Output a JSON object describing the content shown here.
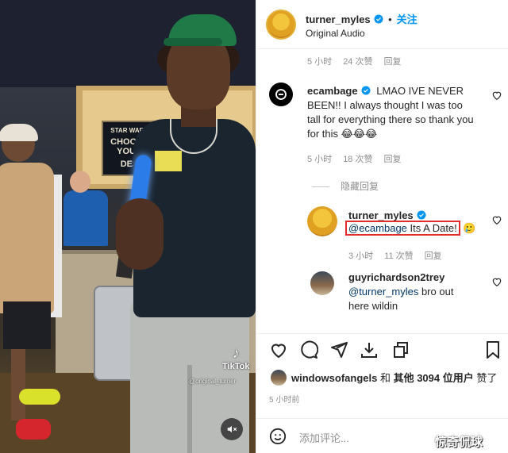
{
  "video": {
    "tiktok_logo": "TikTok",
    "tiktok_handle": "@original_turner",
    "sign_line1": "STAR WARS",
    "sign_line2": "CHOOSE YOUR",
    "sign_line3": "DES",
    "cap_text": "",
    "mute_icon": "speaker-muted-icon"
  },
  "header": {
    "username": "turner_myles",
    "follow_label": "关注",
    "audio_label": "Original Audio"
  },
  "comments": [
    {
      "id": "c0",
      "meta": {
        "time": "5 小时",
        "likes": "24 次赞",
        "reply": "回复"
      }
    },
    {
      "id": "c1",
      "username": "ecambage",
      "text": "LMAO IVE NEVER BEEN!! I always thought I was too tall for everything there so thank you for this 😂😂😂",
      "meta": {
        "time": "5 小时",
        "likes": "18 次赞",
        "reply": "回复"
      },
      "hidden_replies_label": "隐藏回复"
    },
    {
      "id": "c2",
      "username": "turner_myles",
      "mention": "@ecambage",
      "text": " Its A Date!",
      "emoji": "🥲",
      "meta": {
        "time": "3 小时",
        "likes": "11 次赞",
        "reply": "回复"
      }
    },
    {
      "id": "c3",
      "username": "guyrichardson2trey",
      "mention": "@turner_myles",
      "text": " bro out here wildin"
    }
  ],
  "footer": {
    "liked_by_user": "windowsofangels",
    "liked_by_mid": " 和 ",
    "liked_by_others": "其他 3094 位用户",
    "liked_by_suffix": " 赞了",
    "time_ago": "5 小时前",
    "add_comment_placeholder": "添加评论..."
  },
  "watermark": "惊奇侃球",
  "colors": {
    "accent": "#0095f6",
    "highlight_box": "#e22b2b",
    "verified": "#0095f6"
  }
}
